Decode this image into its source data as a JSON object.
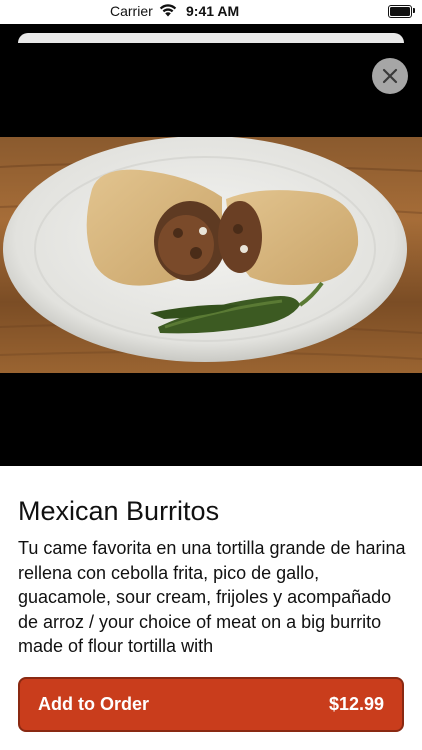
{
  "status_bar": {
    "carrier": "Carrier",
    "time": "9:41 AM",
    "wifi_icon": "wifi-icon",
    "battery_icon": "battery-icon"
  },
  "media": {
    "close_icon": "close-icon",
    "photo_subject": "burrito-photo"
  },
  "item": {
    "title": "Mexican Burritos",
    "description": "Tu came favorita en una tortilla grande de harina rellena con cebolla frita, pico de gallo, guacamole, sour cream, frijoles y acompañado de arroz / your choice of meat on a big burrito made of flour tortilla with"
  },
  "order_button": {
    "label": "Add to Order",
    "price": "$12.99"
  },
  "colors": {
    "accent": "#c93d1c",
    "accent_border": "#8a2912",
    "close_button": "#a6a6a6"
  }
}
